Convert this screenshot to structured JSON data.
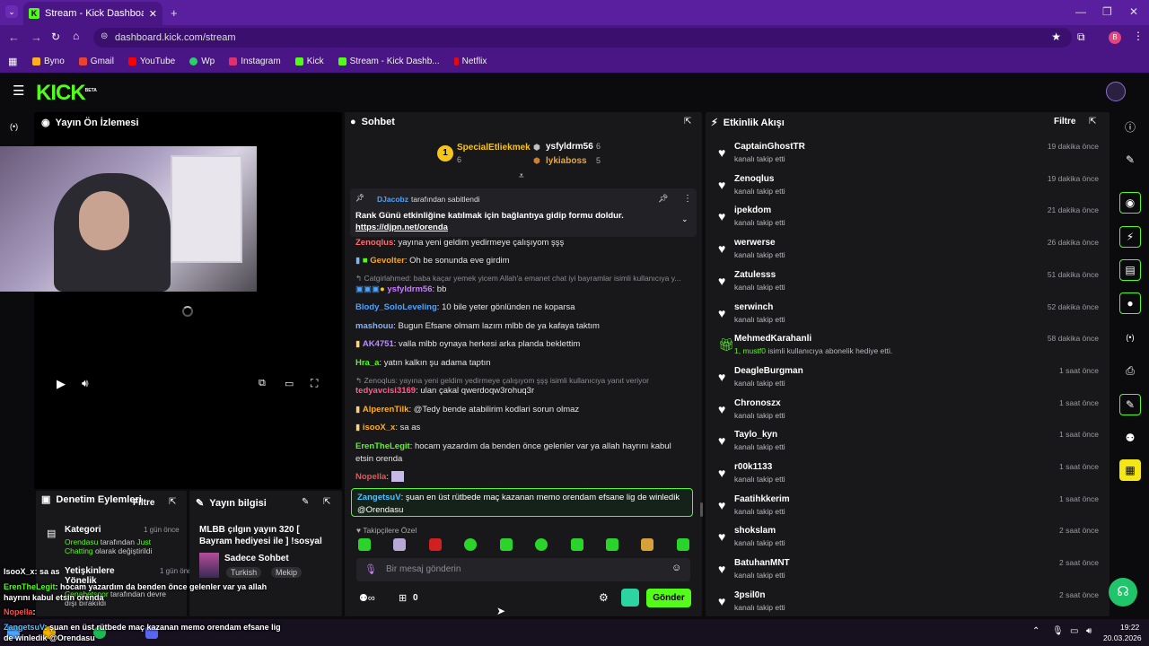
{
  "browser": {
    "tab_title": "Stream - Kick Dashboard",
    "url": "dashboard.kick.com/stream",
    "profile_initial": "B",
    "bookmarks": [
      "Byno",
      "Gmail",
      "YouTube",
      "Wp",
      "Instagram",
      "Kick",
      "Stream - Kick Dashb...",
      "Netflix"
    ]
  },
  "header": {
    "logo": "KICK",
    "beta": "BETA"
  },
  "preview": {
    "title": "Yayın Ön İzlemesi",
    "live_badge": "(•)"
  },
  "mod_actions": {
    "title": "Denetim Eylemleri",
    "filter": "Filtre",
    "items": [
      {
        "title": "Kategori",
        "time": "1 gün önce",
        "user": "Orendasu",
        "text1": "tarafından",
        "value": "Just Chatting",
        "text2": "olarak değiştirildi"
      },
      {
        "title": "Yetişkinlere Yönelik",
        "time": "1 gün önce",
        "user": "Cenabetspor",
        "text1": "tarafından devre dışı bırakıldı"
      }
    ]
  },
  "stream_info": {
    "title": "Yayın bilgisi",
    "stream_title": "MLBB çılgın yayın 320 [ Bayram hediyesi ile ] !sosyal !hediye...",
    "category": "Sadece Sohbet",
    "tags": [
      "Turkish",
      "Mekip"
    ]
  },
  "chat": {
    "title": "Sohbet",
    "leaderboard": [
      {
        "rank": "1",
        "name": "SpecialEtliekmek",
        "count": "6"
      },
      {
        "name": "ysfyldrm56",
        "count": "6"
      },
      {
        "name": "lykiaboss",
        "count": "5"
      }
    ],
    "pinned": {
      "by_user": "DJacobz",
      "by_text": "tarafından sabitlendi",
      "message": "Rank Günü etkinliğine katılmak için bağlantıya gidip formu doldur.",
      "link": "https://djpn.net/orenda"
    },
    "messages": [
      {
        "user": "Zenoqlus",
        "color": "#ff6b6b",
        "text": "yayına yeni geldim yedirmeye çalışıyom şşş"
      },
      {
        "user": "Gevolter",
        "color": "#f5a623",
        "text": "Oh be sonunda eve girdim"
      },
      {
        "reply": "Catgirlahmed: baba kaçar yemek yicem Allah'a emanet chat iyi bayramlar isimli kullanıcıya y..."
      },
      {
        "user": "ysfyldrm56",
        "color": "#c77dff",
        "text": "bb"
      },
      {
        "user": "Blody_SoloLeveling",
        "color": "#4da3ff",
        "text": "10 bile yeter gönlünden ne koparsa"
      },
      {
        "user": "mashouu",
        "color": "#7fb3ff",
        "text": "Bugun Efsane olmam lazım mlbb de ya kafaya taktım"
      },
      {
        "user": "AK4751",
        "color": "#b98cff",
        "text": "valla mlbb oynaya herkesi arka planda beklettim"
      },
      {
        "user": "Hra_a",
        "color": "#53fc18",
        "text": "yatın kalkın şu adama taptın"
      },
      {
        "reply": "Zenoqlus: yayına yeni geldim yedirmeye çalışıyom şşş isimli kullanıcıya yanıt veriyor"
      },
      {
        "user": "tedyavcisi3169",
        "color": "#ff5c8a",
        "text": "ulan çakal qwerdoqw3rohuq3r"
      },
      {
        "user": "AlperenTilk",
        "color": "#ffb020",
        "text": "@Tedy bende atabilirim kodlari sorun olmaz"
      },
      {
        "user": "isooX_x",
        "color": "#ffb020",
        "text": "sa as"
      },
      {
        "user": "ErenTheLegit",
        "color": "#53fc18",
        "text": "hocam yazardım da benden önce gelenler var ya allah hayrını kabul etsin orenda"
      },
      {
        "user": "Nopella",
        "color": "#ff4d4d",
        "text": ""
      }
    ],
    "highlighted": {
      "user": "ZangetsuV",
      "text": "şuan en üst rütbede maç kazanan memo orendam efsane lig de winledik @Orendasu"
    },
    "emote_tab": "Takipçilere Özel",
    "input_placeholder": "Bir mesaj gönderin",
    "points": "0",
    "send": "Gönder"
  },
  "activity": {
    "title": "Etkinlik Akışı",
    "filter": "Filtre",
    "items": [
      {
        "name": "CaptainGhostTR",
        "action": "kanalı takip etti",
        "time": "19 dakika önce"
      },
      {
        "name": "Zenoqlus",
        "action": "kanalı takip etti",
        "time": "19 dakika önce"
      },
      {
        "name": "ipekdom",
        "action": "kanalı takip etti",
        "time": "21 dakika önce"
      },
      {
        "name": "werwerse",
        "action": "kanalı takip etti",
        "time": "26 dakika önce"
      },
      {
        "name": "Zatulesss",
        "action": "kanalı takip etti",
        "time": "51 dakika önce"
      },
      {
        "name": "serwinch",
        "action": "kanalı takip etti",
        "time": "52 dakika önce"
      },
      {
        "name": "MehmedKarahanli",
        "gift_user": "1, mustf0",
        "action": "isimli kullanıcıya abonelik hediye etti.",
        "time": "58 dakika önce"
      },
      {
        "name": "DeagleBurgman",
        "action": "kanalı takip etti",
        "time": "1 saat önce"
      },
      {
        "name": "Chronoszx",
        "action": "kanalı takip etti",
        "time": "1 saat önce"
      },
      {
        "name": "Taylo_kyn",
        "action": "kanalı takip etti",
        "time": "1 saat önce"
      },
      {
        "name": "r00k1133",
        "action": "kanalı takip etti",
        "time": "1 saat önce"
      },
      {
        "name": "Faatihkkerim",
        "action": "kanalı takip etti",
        "time": "1 saat önce"
      },
      {
        "name": "shokslam",
        "action": "kanalı takip etti",
        "time": "2 saat önce"
      },
      {
        "name": "BatuhanMNT",
        "action": "kanalı takip etti",
        "time": "2 saat önce"
      },
      {
        "name": "3psil0n",
        "action": "kanalı takip etti",
        "time": "2 saat önce"
      }
    ]
  },
  "overlay": {
    "lines": [
      {
        "user": "IsooX_x",
        "text": ": sa as"
      },
      {
        "user": "ErenTheLegit",
        "text": ": hocam yazardım da benden önce gelenler var ya allah hayrını kabul etsin orenda"
      },
      {
        "user": "Nopella",
        "text": ":"
      },
      {
        "user": "ZangetsuV",
        "text": ": şuan en üst rütbede maç kazanan memo orendam efsane lig de winledik @Orendasu"
      }
    ]
  },
  "taskbar": {
    "time": "19:22",
    "date": "20.03.2026"
  },
  "colors": {
    "brand": "#53fc18",
    "browser": "#4a1685",
    "panel": "#18181b"
  }
}
